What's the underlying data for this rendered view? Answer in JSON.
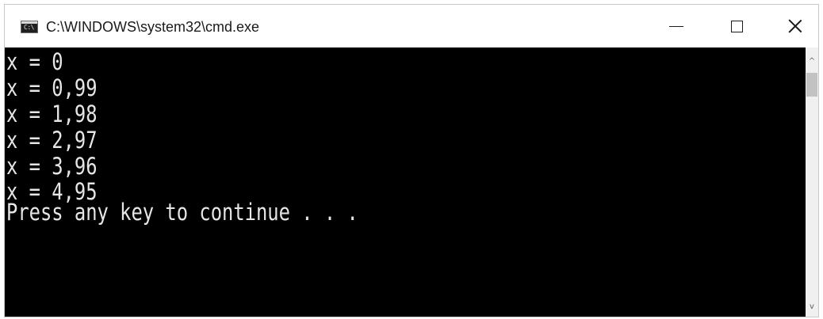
{
  "window": {
    "title": "C:\\WINDOWS\\system32\\cmd.exe",
    "icon": "cmd-icon",
    "icon_text": "C:\\"
  },
  "controls": {
    "minimize_icon": "minimize-icon",
    "maximize_icon": "maximize-icon",
    "close_icon": "close-icon"
  },
  "console": {
    "lines": [
      "x = 0",
      "x = 0,99",
      "x = 1,98",
      "x = 2,97",
      "x = 3,96",
      "x = 4,95",
      "Press any key to continue . . ."
    ]
  },
  "scrollbar": {
    "up_arrow": "^",
    "down_arrow": "v"
  },
  "colors": {
    "console_bg": "#000000",
    "console_text": "#e6e6e6",
    "titlebar_bg": "#ffffff"
  }
}
